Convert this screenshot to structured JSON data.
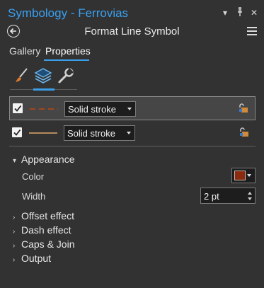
{
  "window": {
    "title": "Symbology - Ferrovias",
    "controls": {
      "dropdown": "▾",
      "pin": "⊥",
      "close": "✕"
    }
  },
  "header": {
    "title": "Format Line Symbol"
  },
  "tabs": [
    {
      "label": "Gallery",
      "active": false
    },
    {
      "label": "Properties",
      "active": true
    }
  ],
  "tool_icons": [
    "brush-icon",
    "layers-icon",
    "wrench-icon"
  ],
  "layers": [
    {
      "checked": true,
      "stroke_type": "Solid stroke",
      "stroke_style": "dashed",
      "stroke_color": "#a2461e",
      "selected": true
    },
    {
      "checked": true,
      "stroke_type": "Solid stroke",
      "stroke_style": "solid",
      "stroke_color": "#b58a5a",
      "selected": false
    }
  ],
  "appearance": {
    "label": "Appearance",
    "color_label": "Color",
    "color_value": "#8b2a0e",
    "width_label": "Width",
    "width_value": "2 pt"
  },
  "sections": [
    "Offset effect",
    "Dash effect",
    "Caps & Join",
    "Output"
  ],
  "accent_color": "#3a9ee8"
}
